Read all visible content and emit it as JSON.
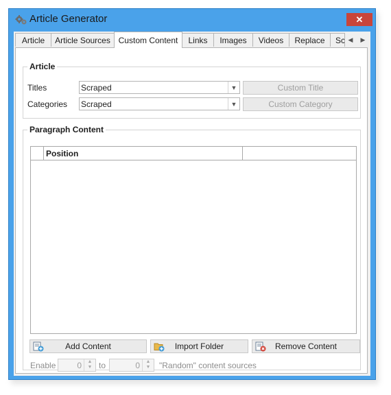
{
  "window": {
    "title": "Article Generator",
    "close_glyph": "✕",
    "icon": "gears-icon"
  },
  "tabs": [
    {
      "label": "Article"
    },
    {
      "label": "Article Sources"
    },
    {
      "label": "Custom Content",
      "active": true
    },
    {
      "label": "Links"
    },
    {
      "label": "Images"
    },
    {
      "label": "Videos"
    },
    {
      "label": "Replace"
    },
    {
      "label": "Sc"
    }
  ],
  "tab_scroll": {
    "left": "◀",
    "right": "▶"
  },
  "article_group": {
    "legend": "Article",
    "titles": {
      "label": "Titles",
      "value": "Scraped",
      "button": "Custom Title"
    },
    "categories": {
      "label": "Categories",
      "value": "Scraped",
      "button": "Custom Category"
    }
  },
  "paragraph_group": {
    "legend": "Paragraph Content",
    "grid": {
      "columns": [
        "Position",
        ""
      ]
    },
    "buttons": {
      "add": "Add Content",
      "import": "Import Folder",
      "remove": "Remove Content"
    },
    "enable": {
      "label": "Enable",
      "from_value": "0",
      "to_label": "to",
      "to_value": "0",
      "suffix": "\"Random\" content sources"
    }
  },
  "combo_arrow": "▼",
  "colors": {
    "frame": "#4aa2ea",
    "close": "#c9453a",
    "client": "#f0f0f0"
  }
}
